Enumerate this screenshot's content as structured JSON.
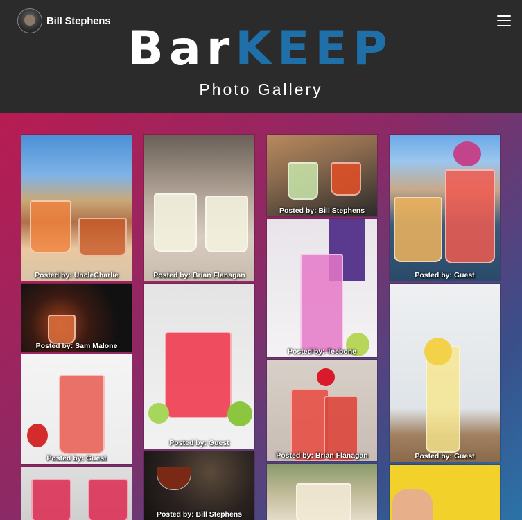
{
  "user": {
    "name": "Bill Stephens",
    "avatar_icon": "user-avatar"
  },
  "logo": {
    "part1": "Bar",
    "part2": "KEEP"
  },
  "subtitle": "Photo Gallery",
  "menu": {
    "icon": "hamburger-menu-icon"
  },
  "colors": {
    "accent": "#1f6fa8",
    "gradient_start": "#b81c52",
    "gradient_end": "#2b73a8"
  },
  "photos": [
    {
      "caption": "Posted by: UncleCharlie"
    },
    {
      "caption": "Posted by: Sam Malone"
    },
    {
      "caption": "Posted by: Guest"
    },
    {
      "caption": ""
    },
    {
      "caption": "Posted by: Brian Flanagan"
    },
    {
      "caption": "Posted by: Guest"
    },
    {
      "caption": "Posted by: Bill Stephens"
    },
    {
      "caption": "Posted by: Bill Stephens"
    },
    {
      "caption": "Posted by: Teebone"
    },
    {
      "caption": "Posted by: Brian Flanagan"
    },
    {
      "caption": ""
    },
    {
      "caption": "Posted by: Guest"
    },
    {
      "caption": "Posted by: Guest"
    },
    {
      "caption": ""
    }
  ]
}
